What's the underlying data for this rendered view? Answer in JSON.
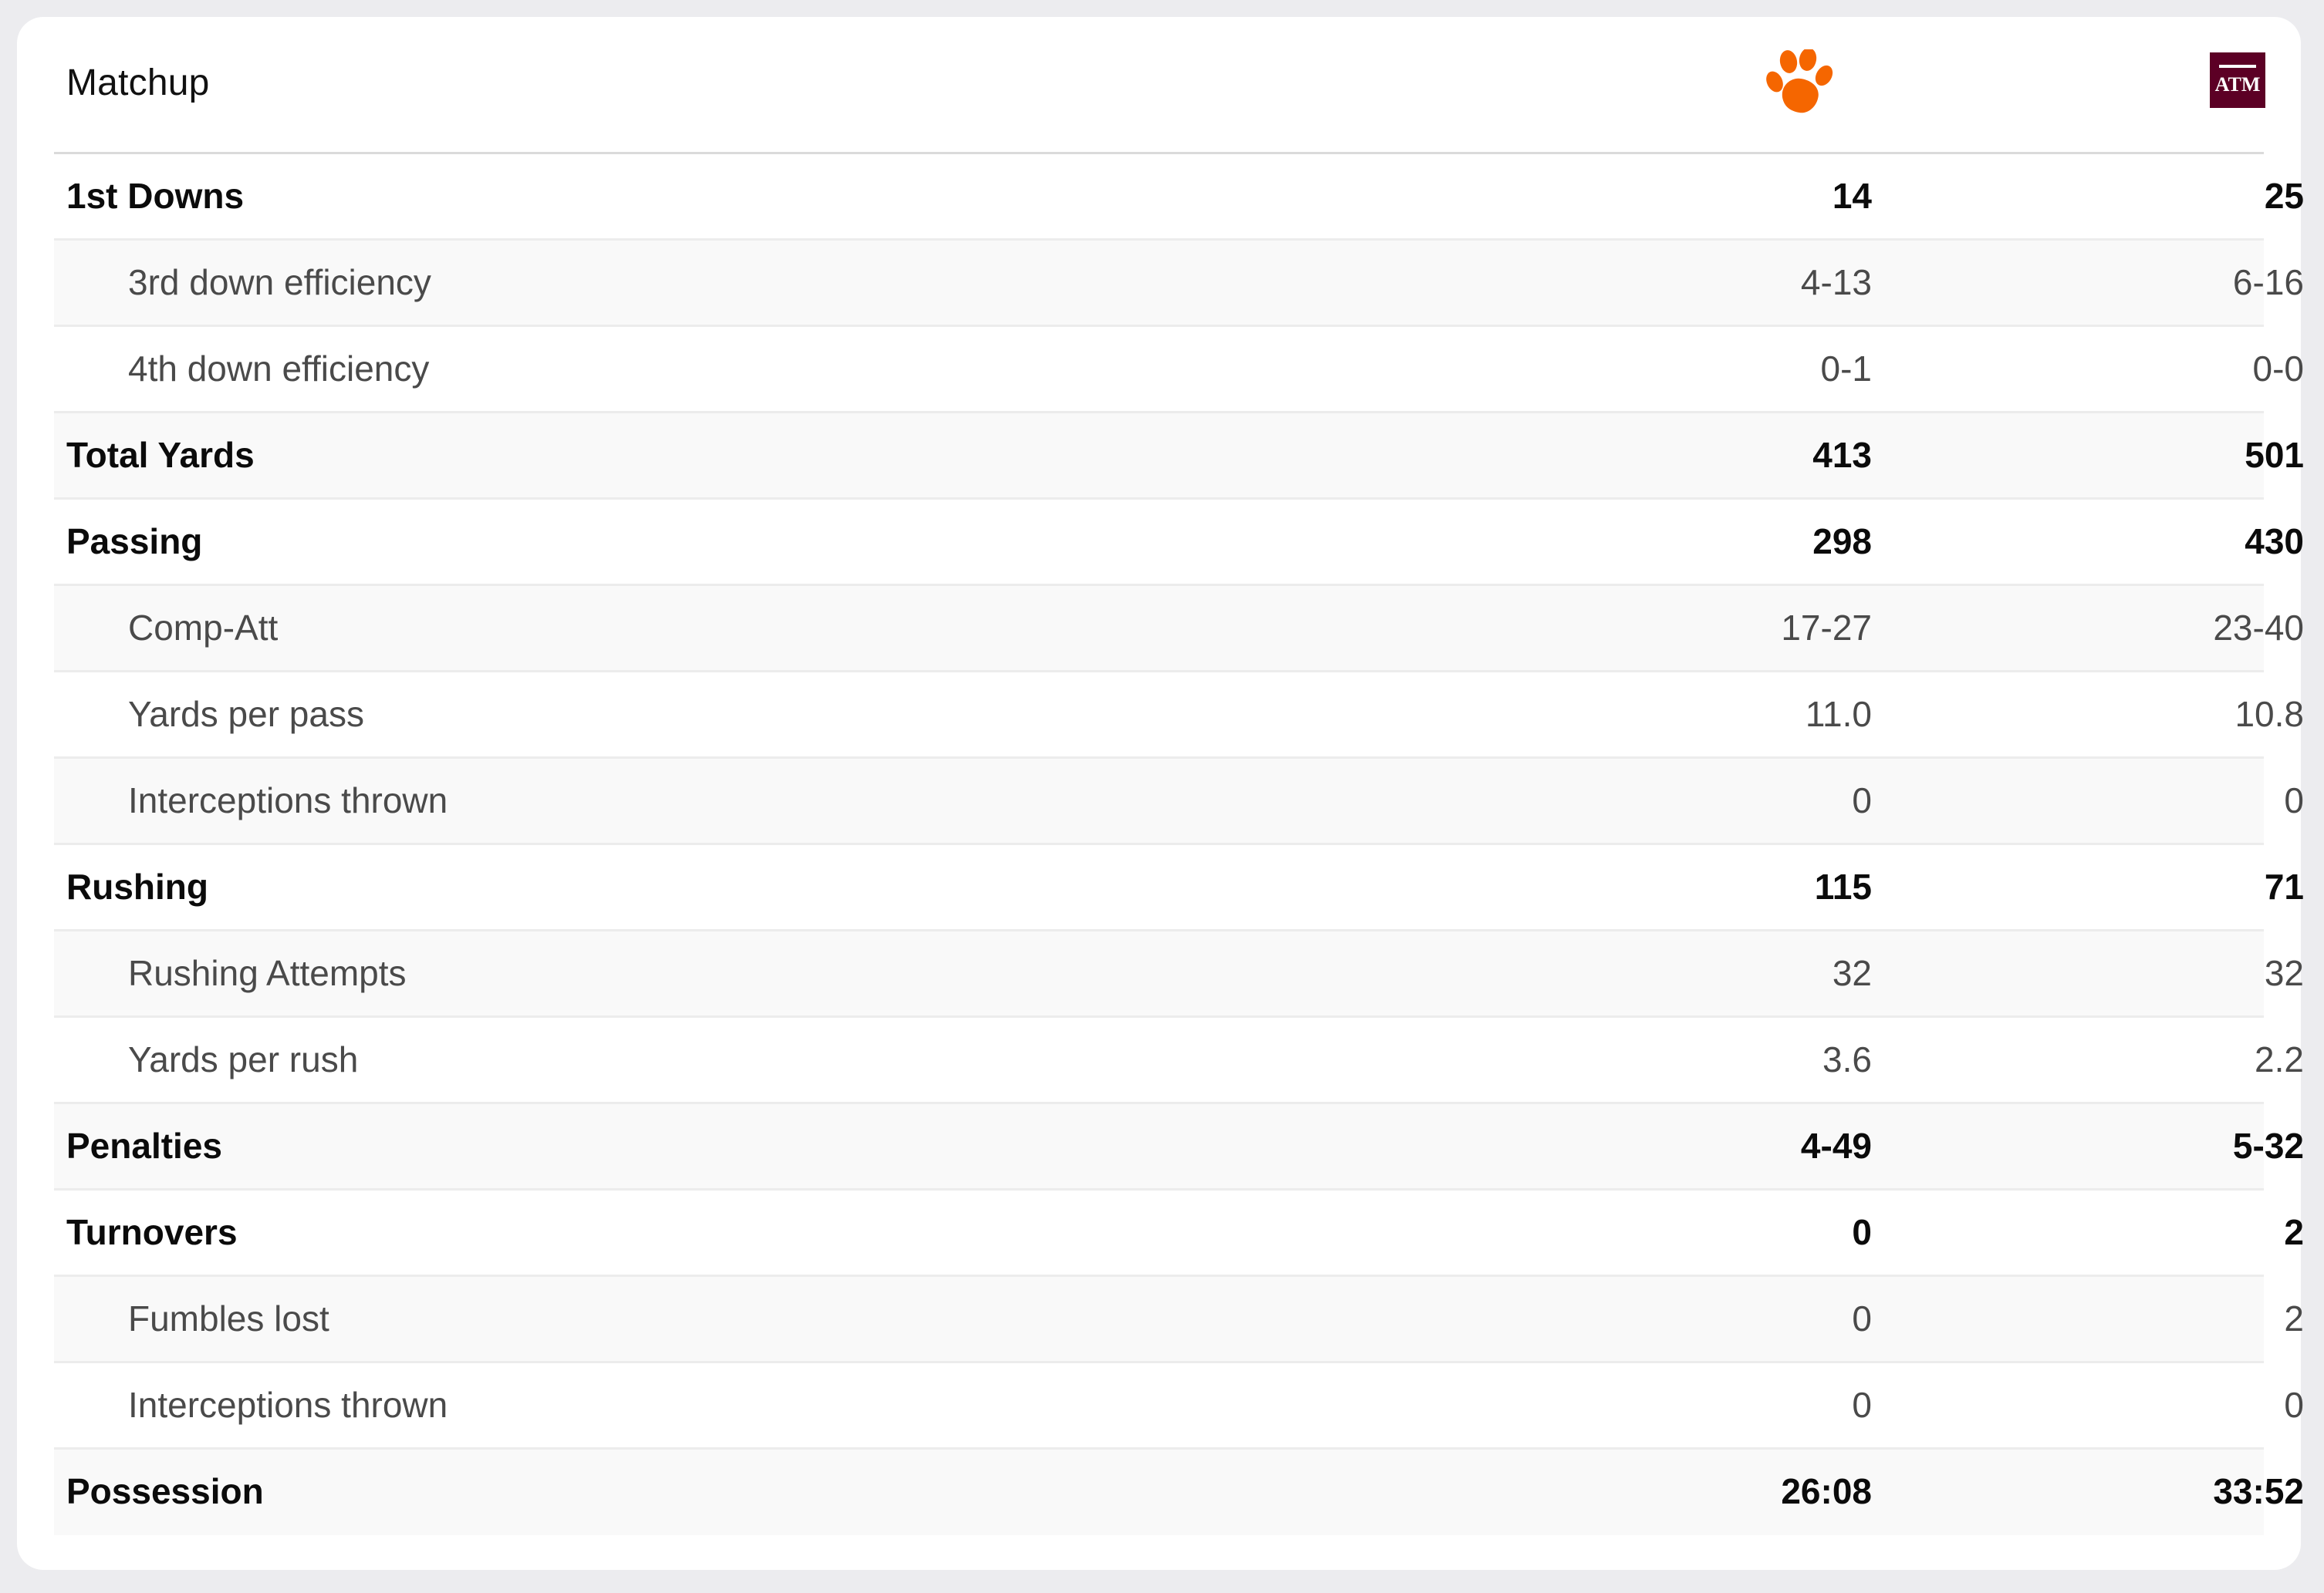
{
  "header": {
    "title": "Matchup",
    "team_a": {
      "logo": "tiger-paw-icon",
      "color": "#f56600"
    },
    "team_b": {
      "logo": "atm-logo-icon",
      "color": "#500000",
      "logo_text": "ATM"
    }
  },
  "rows": [
    {
      "label": "1st Downs",
      "a": "14",
      "b": "25",
      "kind": "main"
    },
    {
      "label": "3rd down efficiency",
      "a": "4-13",
      "b": "6-16",
      "kind": "sub"
    },
    {
      "label": "4th down efficiency",
      "a": "0-1",
      "b": "0-0",
      "kind": "sub"
    },
    {
      "label": "Total Yards",
      "a": "413",
      "b": "501",
      "kind": "main"
    },
    {
      "label": "Passing",
      "a": "298",
      "b": "430",
      "kind": "main"
    },
    {
      "label": "Comp-Att",
      "a": "17-27",
      "b": "23-40",
      "kind": "sub"
    },
    {
      "label": "Yards per pass",
      "a": "11.0",
      "b": "10.8",
      "kind": "sub"
    },
    {
      "label": "Interceptions thrown",
      "a": "0",
      "b": "0",
      "kind": "sub"
    },
    {
      "label": "Rushing",
      "a": "115",
      "b": "71",
      "kind": "main"
    },
    {
      "label": "Rushing Attempts",
      "a": "32",
      "b": "32",
      "kind": "sub"
    },
    {
      "label": "Yards per rush",
      "a": "3.6",
      "b": "2.2",
      "kind": "sub"
    },
    {
      "label": "Penalties",
      "a": "4-49",
      "b": "5-32",
      "kind": "main"
    },
    {
      "label": "Turnovers",
      "a": "0",
      "b": "2",
      "kind": "main"
    },
    {
      "label": "Fumbles lost",
      "a": "0",
      "b": "2",
      "kind": "sub"
    },
    {
      "label": "Interceptions thrown",
      "a": "0",
      "b": "0",
      "kind": "sub"
    },
    {
      "label": "Possession",
      "a": "26:08",
      "b": "33:52",
      "kind": "main"
    }
  ]
}
